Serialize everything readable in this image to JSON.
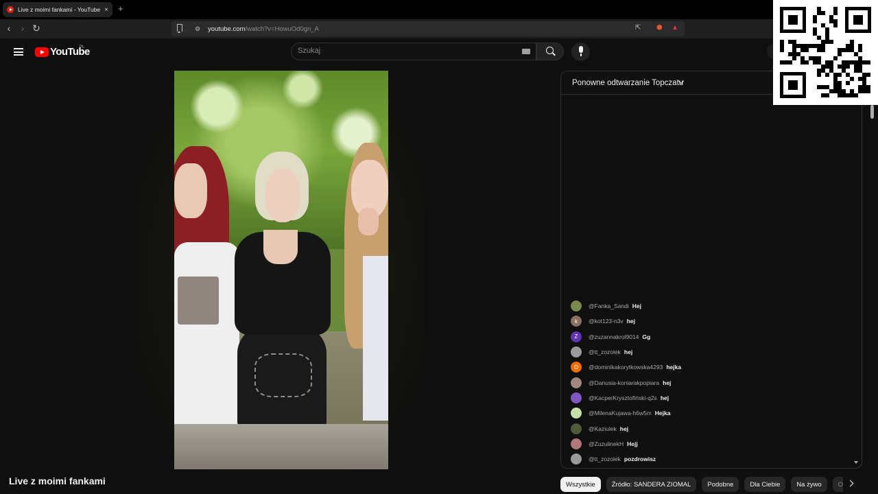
{
  "browser": {
    "tab_title": "Live z moimi fankami - YouTube",
    "tab_close": "×",
    "new_tab": "+",
    "back": "‹",
    "forward": "›",
    "reload": "↻",
    "site_info_icon": "⚙",
    "url_host": "youtube.com",
    "url_path": "/watch?v=HowuOd0gn_A",
    "share_icon": "⇱",
    "ext1_icon": "⬢",
    "ext2_icon": "▲"
  },
  "header": {
    "logo_text": "YouTube",
    "region": "PL",
    "search_placeholder": "Szukaj"
  },
  "video": {
    "title": "Live z moimi fankami"
  },
  "chat": {
    "header_label": "Ponowne odtwarzanie Topczatu",
    "messages": [
      {
        "author": "@Fanka_Sandi",
        "text": "Hej",
        "avatar_color": "#7a8a4a",
        "initial": ""
      },
      {
        "author": "@kot123-n3v",
        "text": "hej",
        "avatar_color": "#8d6e63",
        "initial": "k"
      },
      {
        "author": "@zuzannakrol9014",
        "text": "Gg",
        "avatar_color": "#5e35b1",
        "initial": "Z"
      },
      {
        "author": "@tt_zozolek",
        "text": "hej",
        "avatar_color": "#9a9a9a",
        "initial": ""
      },
      {
        "author": "@dominikakorytkowska4293",
        "text": "hejka",
        "avatar_color": "#ef6c00",
        "initial": "D"
      },
      {
        "author": "@Danusia-koniarakpopiara",
        "text": "hej",
        "avatar_color": "#a1887f",
        "initial": ""
      },
      {
        "author": "@KacperKrysztofiński-q2s",
        "text": "hej",
        "avatar_color": "#7e57c2",
        "initial": ""
      },
      {
        "author": "@MilenaKujawa-h6w5m",
        "text": "Hejka",
        "avatar_color": "#c5e1a5",
        "initial": ""
      },
      {
        "author": "@Kaziulek",
        "text": "hej",
        "avatar_color": "#4e5a3a",
        "initial": ""
      },
      {
        "author": "@ZuzulinekH",
        "text": "Hejj",
        "avatar_color": "#b0787a",
        "initial": ""
      },
      {
        "author": "@tt_zozolek",
        "text": "pozdrowisz",
        "avatar_color": "#9a9a9a",
        "initial": ""
      }
    ]
  },
  "chips": [
    {
      "label": "Wszystkie"
    },
    {
      "label": "Źródło: SANDERA ZIOMAL"
    },
    {
      "label": "Podobne"
    },
    {
      "label": "Dla Ciebie"
    },
    {
      "label": "Na żywo"
    },
    {
      "label": "Ostat"
    }
  ]
}
